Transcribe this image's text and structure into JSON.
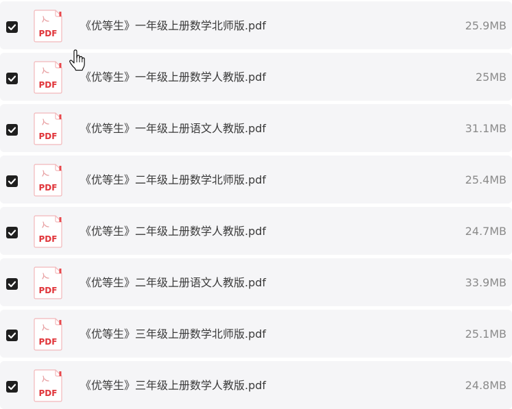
{
  "colors": {
    "row_background": "#f5f5f7",
    "checkbox": "#1f1f1f",
    "pdf_accent": "#e8474b",
    "filename_text": "#3a3a3a",
    "size_text": "#8a8a8a"
  },
  "file_icon": "pdf-file-icon",
  "file_icon_label": "PDF",
  "files": [
    {
      "name": "《优等生》一年级上册数学北师版.pdf",
      "size": "25.9MB",
      "checked": true
    },
    {
      "name": "《优等生》一年级上册数学人教版.pdf",
      "size": "25MB",
      "checked": true
    },
    {
      "name": "《优等生》一年级上册语文人教版.pdf",
      "size": "31.1MB",
      "checked": true
    },
    {
      "name": "《优等生》二年级上册数学北师版.pdf",
      "size": "25.4MB",
      "checked": true
    },
    {
      "name": "《优等生》二年级上册数学人教版.pdf",
      "size": "24.7MB",
      "checked": true
    },
    {
      "name": "《优等生》二年级上册语文人教版.pdf",
      "size": "33.9MB",
      "checked": true
    },
    {
      "name": "《优等生》三年级上册数学北师版.pdf",
      "size": "25.1MB",
      "checked": true
    },
    {
      "name": "《优等生》三年级上册数学人教版.pdf",
      "size": "24.8MB",
      "checked": true
    }
  ]
}
